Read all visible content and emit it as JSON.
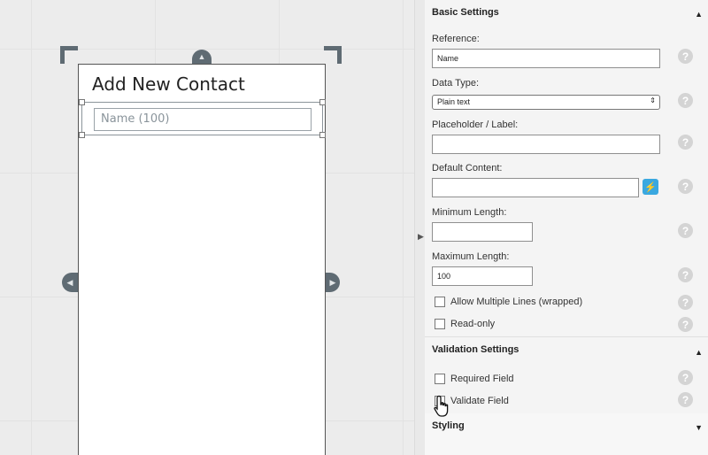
{
  "canvas": {
    "screen_title": "Add New Contact",
    "name_field_placeholder": "Name (100)"
  },
  "basic_settings": {
    "title": "Basic Settings",
    "reference_label": "Reference:",
    "reference_value": "Name",
    "data_type_label": "Data Type:",
    "data_type_value": "Plain text",
    "placeholder_label": "Placeholder / Label:",
    "placeholder_value": "",
    "default_content_label": "Default Content:",
    "default_content_value": "",
    "min_length_label": "Minimum Length:",
    "min_length_value": "",
    "max_length_label": "Maximum Length:",
    "max_length_value": "100",
    "allow_multiple_lines_label": "Allow Multiple Lines (wrapped)",
    "read_only_label": "Read-only"
  },
  "validation_settings": {
    "title": "Validation Settings",
    "required_field_label": "Required Field",
    "validate_field_label": "Validate Field"
  },
  "styling": {
    "title": "Styling"
  },
  "icons": {
    "help": "?",
    "bolt": "⚡"
  },
  "colors": {
    "accent": "#3aa8e0",
    "handle": "#5f6b73"
  }
}
